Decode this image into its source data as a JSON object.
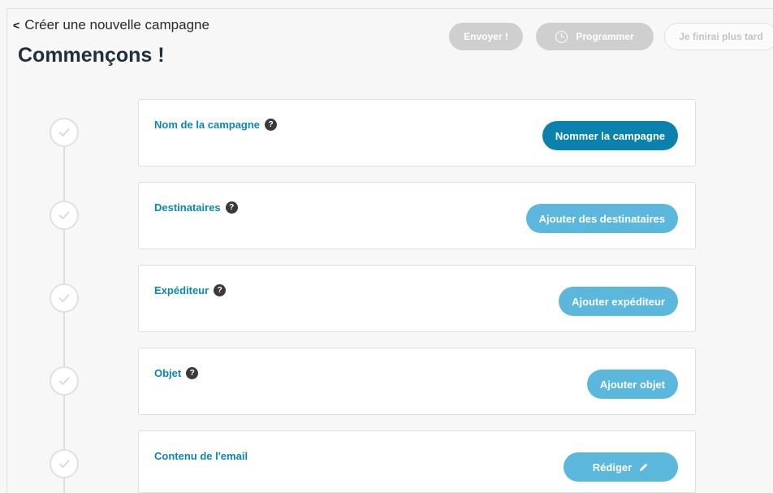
{
  "header": {
    "back_label": "Créer une nouvelle campagne",
    "back_chevron": "<",
    "title": "Commençons !"
  },
  "actions": {
    "send": "Envoyer !",
    "schedule": "Programmer",
    "later": "Je finirai plus tard"
  },
  "steps": [
    {
      "label": "Nom de la campagne",
      "button": "Nommer la campagne",
      "has_help": true
    },
    {
      "label": "Destinataires",
      "button": "Ajouter des destinataires",
      "has_help": true
    },
    {
      "label": "Expéditeur",
      "button": "Ajouter expéditeur",
      "has_help": true
    },
    {
      "label": "Objet",
      "button": "Ajouter objet",
      "has_help": true
    },
    {
      "label": "Contenu de l'email",
      "button": "Rédiger",
      "has_help": false
    }
  ],
  "icons": {
    "help": "?",
    "check": "check-icon",
    "clock": "clock-icon",
    "pencil": "pencil-icon"
  },
  "colors": {
    "accent": "#0b82ad",
    "accent_light": "#5bb7dc",
    "label": "#0c87b5",
    "disabled": "#cfcfcf"
  }
}
